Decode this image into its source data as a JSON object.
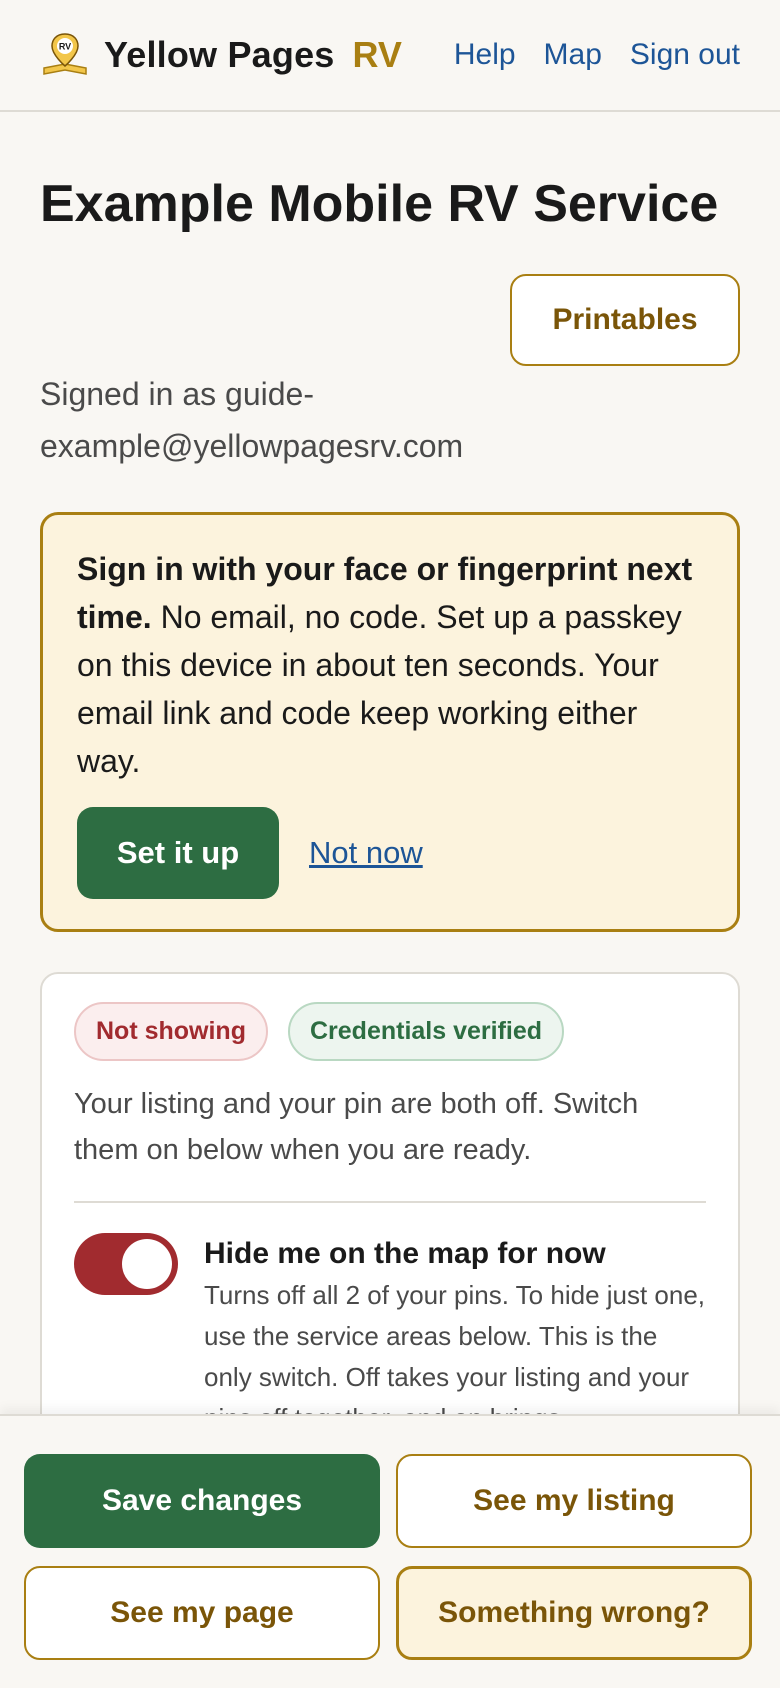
{
  "header": {
    "brand": "Yellow Pages",
    "brand_suffix": "RV",
    "logo_icon": "rv-map-pin-book-icon",
    "nav": [
      "Help",
      "Map",
      "Sign out"
    ]
  },
  "page": {
    "title": "Example Mobile RV Service",
    "printables_label": "Printables",
    "signed_in": "Signed in as guide-example@yellowpagesrv.com"
  },
  "passkey": {
    "bold": "Sign in with your face or fingerprint next time.",
    "text": " No email, no code. Set up a passkey on this device in about ten seconds. Your email link and code keep working either way.",
    "setup_label": "Set it up",
    "dismiss_label": "Not now"
  },
  "status": {
    "badges": [
      "Not showing",
      "Credentials verified"
    ],
    "description": "Your listing and your pin are both off. Switch them on below when you are ready.",
    "toggle": {
      "title": "Hide me on the map for now",
      "description": "Turns off all 2 of your pins. To hide just one, use the service areas below. This is the only switch. Off takes your listing and your pins off together, and on brings",
      "on": true
    }
  },
  "footer": {
    "save": "Save changes",
    "listing": "See my listing",
    "page": "See my page",
    "wrong": "Something wrong?"
  },
  "colors": {
    "accent": "#a97f12",
    "primary_green": "#2d6d42",
    "link_blue": "#1d5597",
    "alert_red": "#a12b2f",
    "passkey_bg": "#fcf3dd",
    "page_bg": "#f9f7f3"
  }
}
